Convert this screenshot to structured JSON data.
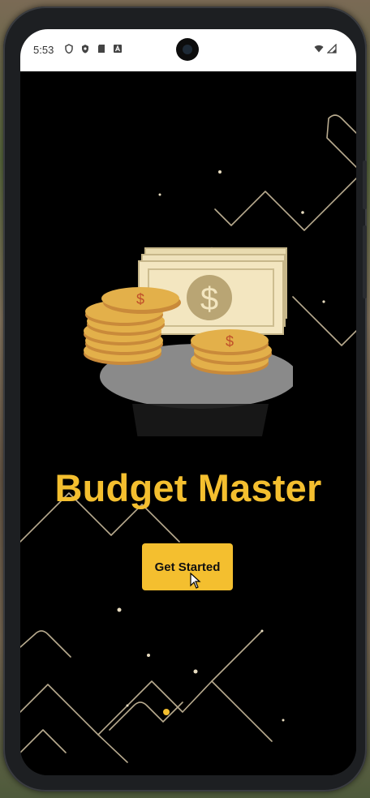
{
  "status_bar": {
    "time": "5:53",
    "left_icons": [
      "vpn-key-icon",
      "shield-icon",
      "sd-card-icon",
      "font-icon"
    ],
    "right_icons": [
      "wifi-icon",
      "signal-icon"
    ]
  },
  "app": {
    "title": "Budget Master",
    "cta_label": "Get Started",
    "illustration": "money-coins-icon"
  },
  "colors": {
    "accent": "#f4bf2f",
    "background": "#000000",
    "status_bar_bg": "#ffffff",
    "line_color": "#d9c9a8"
  }
}
